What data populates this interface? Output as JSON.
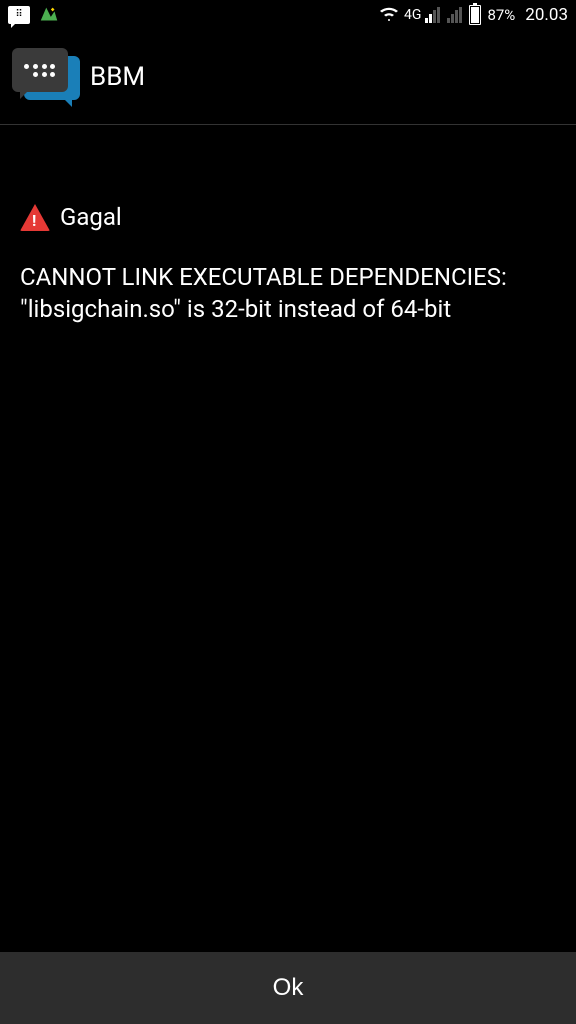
{
  "statusBar": {
    "networkType": "4G",
    "batteryPercent": "87%",
    "time": "20.03"
  },
  "header": {
    "appName": "BBM"
  },
  "dialog": {
    "errorTitle": "Gagal",
    "errorMessage": "CANNOT LINK EXECUTABLE DEPENDENCIES: \"libsigchain.so\" is 32-bit instead of 64-bit",
    "okButton": "Ok"
  }
}
